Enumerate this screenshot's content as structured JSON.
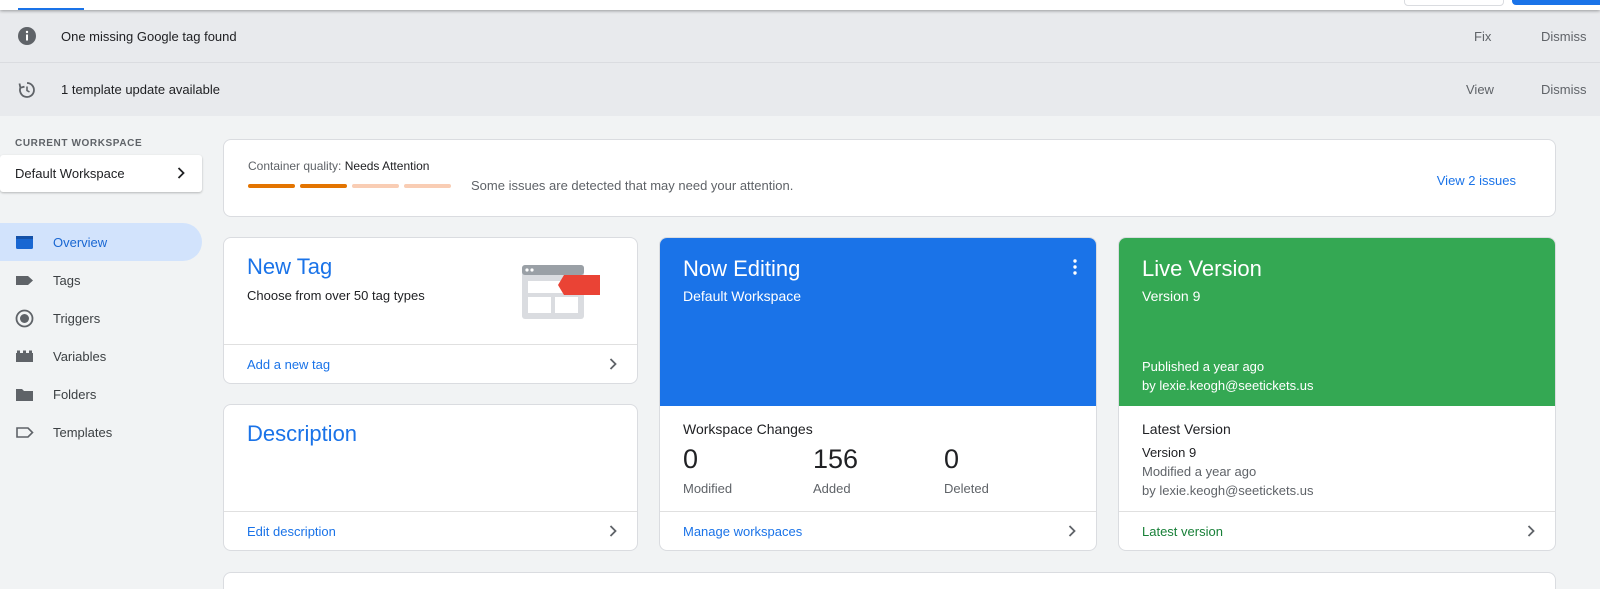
{
  "notifications": [
    {
      "text": "One missing Google tag found",
      "actions": [
        "Fix",
        "Dismiss"
      ],
      "icon": "info-icon"
    },
    {
      "text": "1 template update available",
      "actions": [
        "View",
        "Dismiss"
      ],
      "icon": "update-icon"
    }
  ],
  "sidebar": {
    "workspace_label": "CURRENT WORKSPACE",
    "workspace_name": "Default Workspace",
    "items": [
      {
        "label": "Overview",
        "icon": "overview-icon",
        "active": true
      },
      {
        "label": "Tags",
        "icon": "tag-icon"
      },
      {
        "label": "Triggers",
        "icon": "trigger-icon"
      },
      {
        "label": "Variables",
        "icon": "variables-icon"
      },
      {
        "label": "Folders",
        "icon": "folder-icon"
      },
      {
        "label": "Templates",
        "icon": "template-icon"
      }
    ]
  },
  "quality": {
    "label": "Container quality:",
    "status": "Needs Attention",
    "description": "Some issues are detected that may need your attention.",
    "link": "View 2 issues",
    "segments_filled": 2,
    "segments_total": 4
  },
  "new_tag": {
    "title": "New Tag",
    "subtitle": "Choose from over 50 tag types",
    "link": "Add a new tag"
  },
  "description_card": {
    "title": "Description",
    "link": "Edit description"
  },
  "now_editing": {
    "title": "Now Editing",
    "subtitle": "Default Workspace",
    "changes_title": "Workspace Changes",
    "stats": [
      {
        "value": "0",
        "label": "Modified"
      },
      {
        "value": "156",
        "label": "Added"
      },
      {
        "value": "0",
        "label": "Deleted"
      }
    ],
    "link": "Manage workspaces"
  },
  "live_version": {
    "title": "Live Version",
    "subtitle": "Version 9",
    "published": "Published a year ago",
    "published_by": "by lexie.keogh@seetickets.us",
    "latest_title": "Latest Version",
    "latest_version": "Version 9",
    "latest_modified": "Modified a year ago",
    "latest_by": "by lexie.keogh@seetickets.us",
    "link": "Latest version"
  },
  "colors": {
    "primary": "#1a73e8",
    "editing_bg": "#1a73e8",
    "live_bg": "#34a853",
    "quality_filled": "#e37400",
    "quality_empty": "#f9cdb4",
    "live_link": "#188038"
  }
}
